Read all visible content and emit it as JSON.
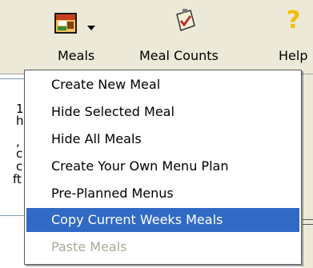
{
  "toolbar": {
    "meals_label": "Meals",
    "meal_counts_label": "Meal Counts",
    "help_label": "Help"
  },
  "menu": {
    "items": [
      {
        "label": "Create New Meal",
        "state": "normal"
      },
      {
        "label": "Hide Selected Meal",
        "state": "normal"
      },
      {
        "label": "Hide All Meals",
        "state": "normal"
      },
      {
        "label": "Create Your Own Menu Plan",
        "state": "normal"
      },
      {
        "label": "Pre-Planned Menus",
        "state": "normal"
      },
      {
        "label": "Copy Current Weeks Meals",
        "state": "selected"
      },
      {
        "label": "Paste Meals",
        "state": "disabled"
      }
    ]
  },
  "background": {
    "fragments": [
      "1",
      "h",
      ",",
      "c",
      "c",
      "ft"
    ]
  },
  "colors": {
    "toolbar_bg": "#ece9d8",
    "selection": "#316ac5",
    "disabled_text": "#aca899"
  }
}
